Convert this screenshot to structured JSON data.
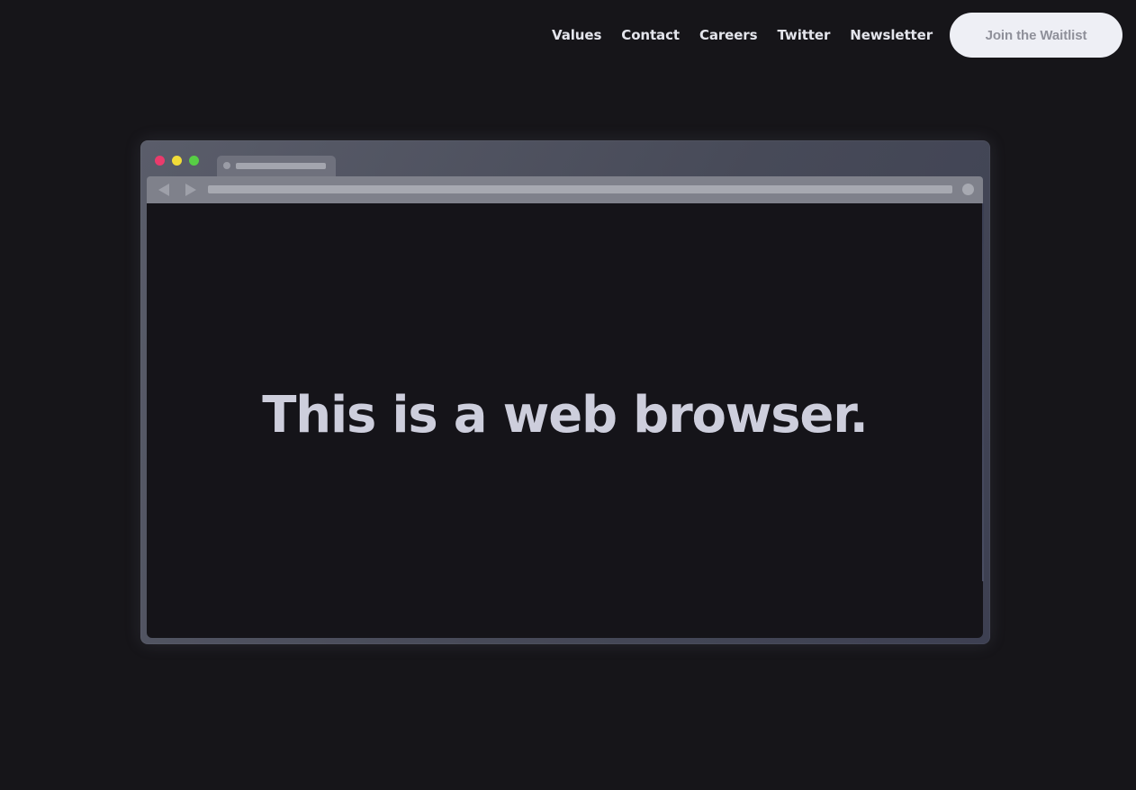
{
  "nav": {
    "links": [
      {
        "label": "Values"
      },
      {
        "label": "Contact"
      },
      {
        "label": "Careers"
      },
      {
        "label": "Twitter"
      },
      {
        "label": "Newsletter"
      }
    ],
    "cta_label": "Join the Waitlist"
  },
  "browser_mockup": {
    "window_controls": [
      {
        "name": "close",
        "color": "#ea3b6c"
      },
      {
        "name": "minimize",
        "color": "#f1dc38"
      },
      {
        "name": "maximize",
        "color": "#57cd45"
      }
    ],
    "toolbar_icons": [
      "back-arrow-icon",
      "forward-arrow-icon",
      "reload-icon"
    ],
    "headline": "This is a web browser."
  },
  "colors": {
    "background": "#161519",
    "nav_text": "#e4e5ec",
    "cta_background": "#eeeff5",
    "cta_text": "#8f909a",
    "headline_text": "#cdcedc"
  }
}
